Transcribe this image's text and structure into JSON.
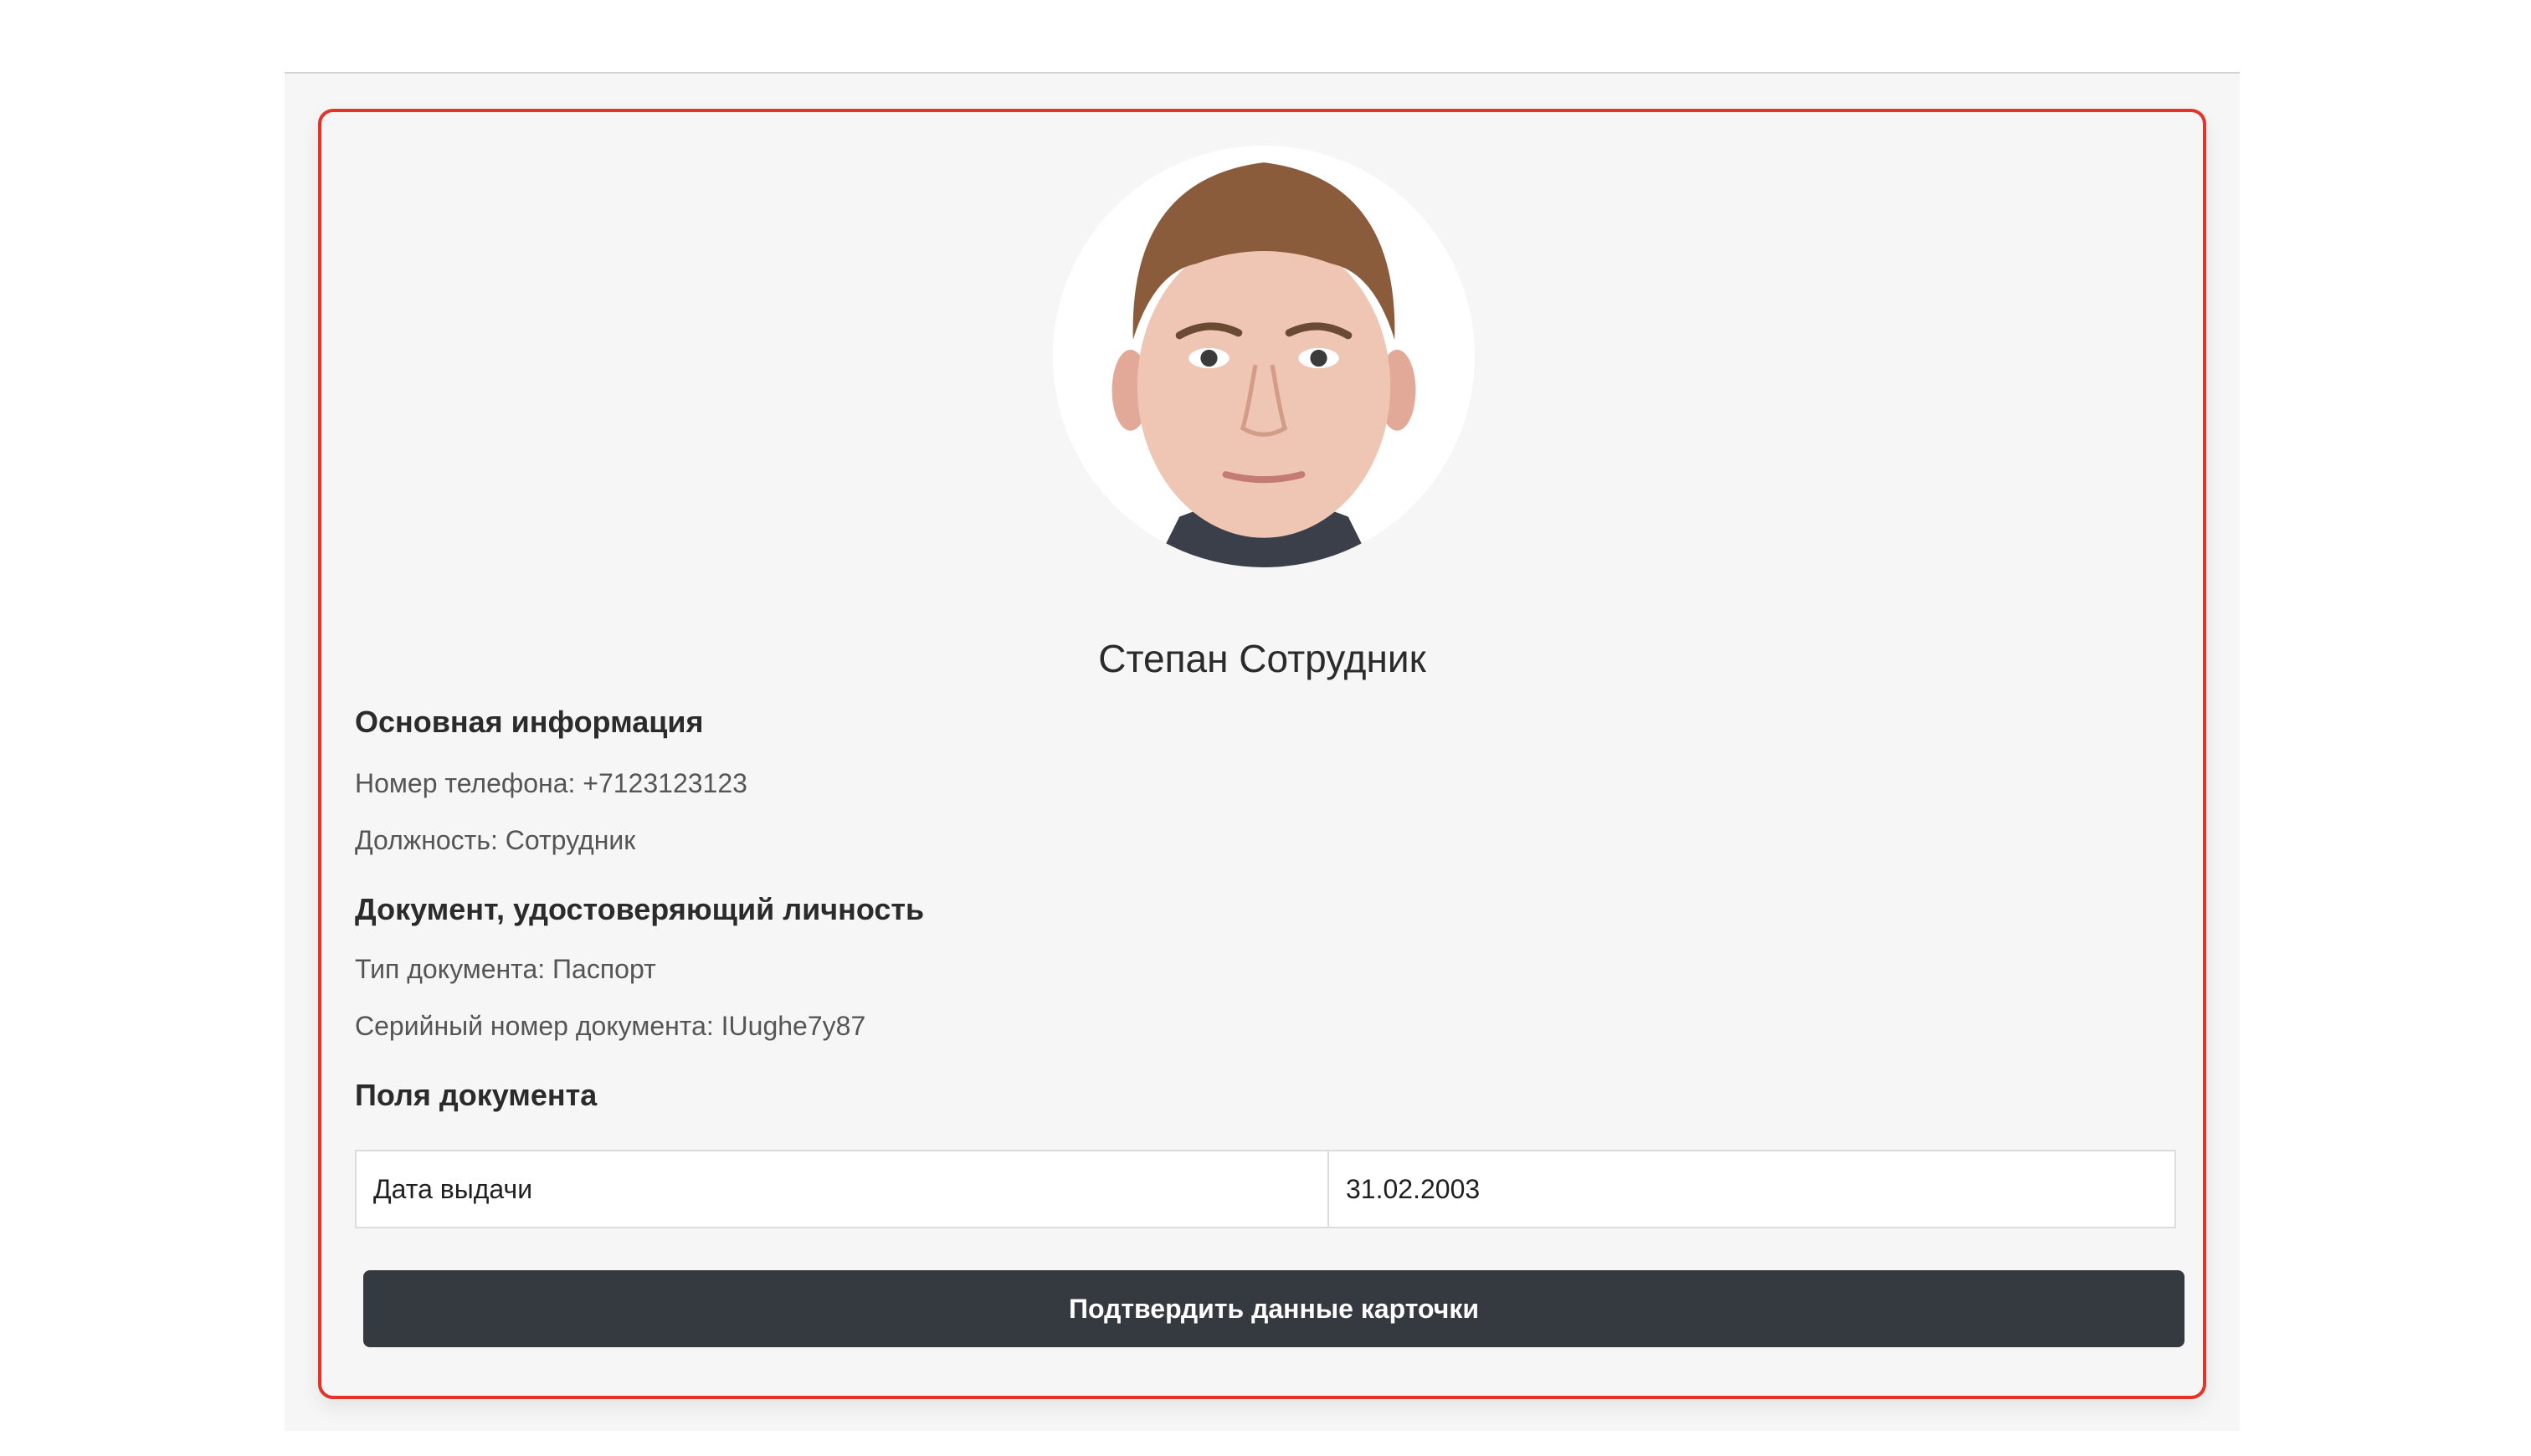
{
  "profile": {
    "full_name": "Степан Сотрудник",
    "photo_icon": "person-portrait"
  },
  "main_info": {
    "title": "Основная информация",
    "phone_line": "Номер телефона: +7123123123",
    "position_line": "Должность: Сотрудник"
  },
  "id_document": {
    "title": "Документ, удостоверяющий личность",
    "type_line": "Тип документа: Паспорт",
    "serial_line": "Серийный номер документа: IUughe7y87"
  },
  "document_fields": {
    "title": "Поля документа",
    "rows": [
      {
        "key": "Дата выдачи",
        "value": "31.02.2003"
      }
    ]
  },
  "actions": {
    "confirm_label": "Подтвердить данные карточки"
  },
  "colors": {
    "card_border": "#e5332a",
    "button_bg": "#343a40",
    "page_bg": "#f6f6f6"
  }
}
